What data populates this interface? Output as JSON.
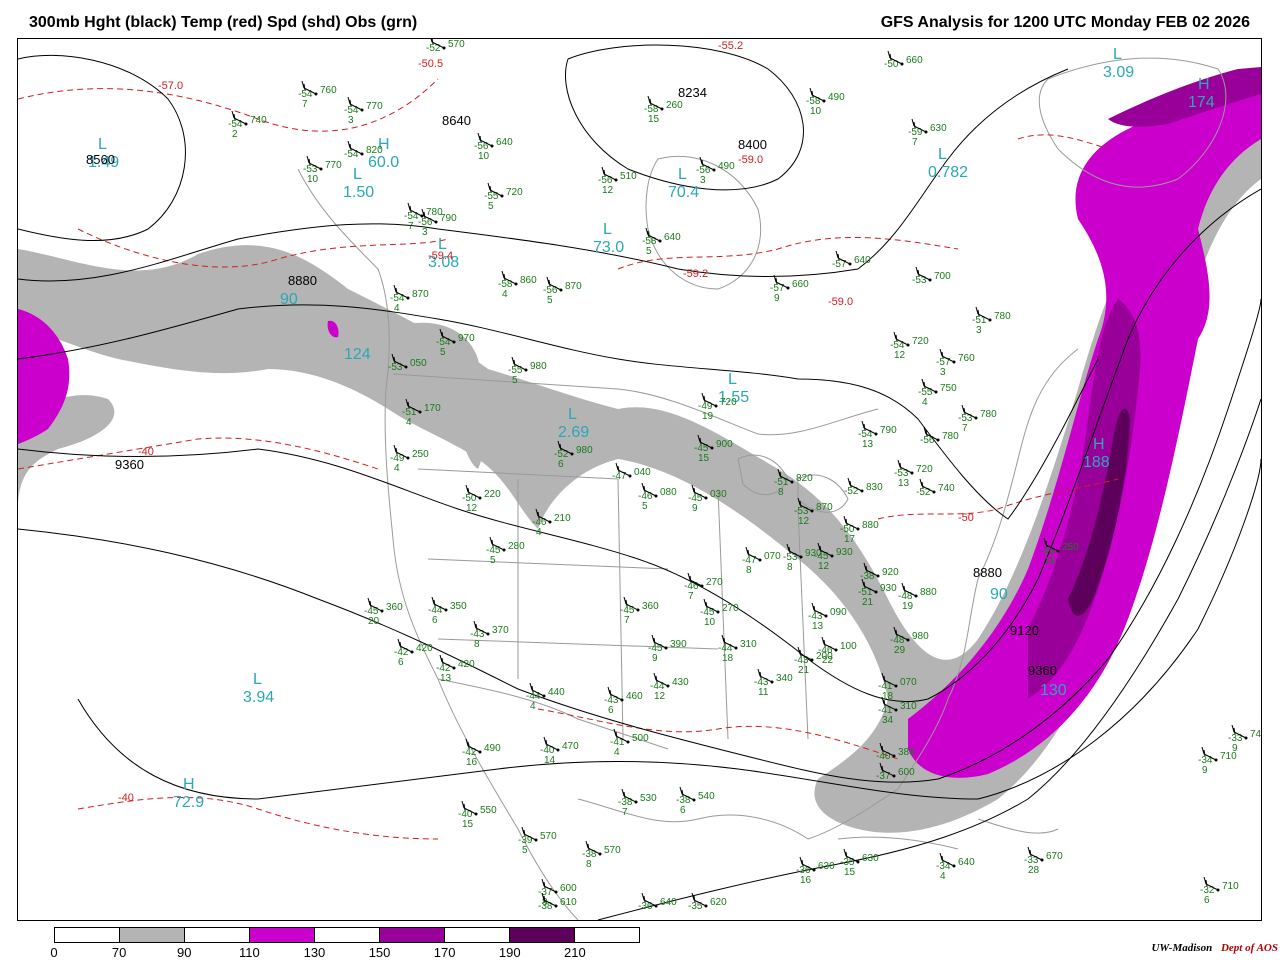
{
  "header": {
    "title_left": "300mb Hght (black) Temp (red) Spd (shd) Obs (grn)",
    "title_right": "GFS Analysis for 1200 UTC Monday  FEB 02 2026"
  },
  "colors": {
    "height_contour": "#000000",
    "temperature_contour": "#cc2020",
    "observation_text": "#1a7a1a",
    "speed_label": "#2aa8b8",
    "speed_70_90": "#b4b4b4",
    "speed_110_130": "#cc00cc",
    "speed_150_170": "#990099",
    "speed_190_210": "#5c005c",
    "geography": "#9a9a9a"
  },
  "colorbar": {
    "segments": [
      "#ffffff",
      "#b4b4b4",
      "#ffffff",
      "#cc00cc",
      "#ffffff",
      "#990099",
      "#ffffff",
      "#5c005c",
      "#ffffff"
    ],
    "ticks": [
      "0",
      "70",
      "90",
      "110",
      "130",
      "150",
      "170",
      "190",
      "210"
    ]
  },
  "credit": {
    "university": "UW-Madison",
    "department": "Dept of AOS"
  },
  "height_labels": [
    "8560",
    "8640",
    "8234",
    "8400",
    "8880",
    "9360",
    "8880",
    "9120",
    "9360"
  ],
  "temperature_labels": [
    "-57.0",
    "-50.5",
    "-55.2",
    "-59.0",
    "-59.4",
    "-59.2",
    "-59.0",
    "-40",
    "-40",
    "-50"
  ],
  "speed_centers": [
    {
      "letter": "L",
      "value": "1.49"
    },
    {
      "letter": "H",
      "value": "60.0"
    },
    {
      "letter": "L",
      "value": "1.50"
    },
    {
      "letter": "L",
      "value": "3.08"
    },
    {
      "letter": "L",
      "value": "70.4"
    },
    {
      "letter": "L",
      "value": "73.0"
    },
    {
      "letter": "L",
      "value": "0.782"
    },
    {
      "letter": "L",
      "value": "3.09"
    },
    {
      "letter": "H",
      "value": "174"
    },
    {
      "letter": "L",
      "value": "1.55"
    },
    {
      "letter": "L",
      "value": "2.69"
    },
    {
      "letter": "H",
      "value": "188"
    },
    {
      "letter": "L",
      "value": "3.94"
    },
    {
      "letter": "H",
      "value": "72.9"
    }
  ],
  "speed_values": [
    "90",
    "124",
    "90",
    "130"
  ],
  "observations": [
    {
      "temp": "-54",
      "height": "760",
      "wind": "7"
    },
    {
      "temp": "-54",
      "height": "770",
      "wind": "3"
    },
    {
      "temp": "-54",
      "height": "740",
      "wind": "2"
    },
    {
      "temp": "-54",
      "height": "820",
      "wind": ""
    },
    {
      "temp": "-53",
      "height": "770",
      "wind": "10"
    },
    {
      "temp": "-52",
      "height": "570",
      "wind": ""
    },
    {
      "temp": "-56",
      "height": "640",
      "wind": "10"
    },
    {
      "temp": "-55",
      "height": "720",
      "wind": "5"
    },
    {
      "temp": "-54",
      "height": "780",
      "wind": "7"
    },
    {
      "temp": "-56",
      "height": "790",
      "wind": "3"
    },
    {
      "temp": "-58",
      "height": "860",
      "wind": "4"
    },
    {
      "temp": "-56",
      "height": "870",
      "wind": "5"
    },
    {
      "temp": "-54",
      "height": "870",
      "wind": "4"
    },
    {
      "temp": "-56",
      "height": "510",
      "wind": "12"
    },
    {
      "temp": "-56",
      "height": "490",
      "wind": "3"
    },
    {
      "temp": "-58",
      "height": "640",
      "wind": "5"
    },
    {
      "temp": "-58",
      "height": "260",
      "wind": "15"
    },
    {
      "temp": "-58",
      "height": "490",
      "wind": "10"
    },
    {
      "temp": "-59",
      "height": "630",
      "wind": "7"
    },
    {
      "temp": "-50",
      "height": "660",
      "wind": ""
    },
    {
      "temp": "-57",
      "height": "640",
      "wind": ""
    },
    {
      "temp": "-57",
      "height": "660",
      "wind": "9"
    },
    {
      "temp": "-53",
      "height": "700",
      "wind": ""
    },
    {
      "temp": "-51",
      "height": "780",
      "wind": "3"
    },
    {
      "temp": "-54",
      "height": "720",
      "wind": "12"
    },
    {
      "temp": "-57",
      "height": "760",
      "wind": "3"
    },
    {
      "temp": "-55",
      "height": "750",
      "wind": "4"
    },
    {
      "temp": "-53",
      "height": "780",
      "wind": "7"
    },
    {
      "temp": "-56",
      "height": "780",
      "wind": ""
    },
    {
      "temp": "-54",
      "height": "790",
      "wind": "13"
    },
    {
      "temp": "-53",
      "height": "720",
      "wind": "13"
    },
    {
      "temp": "-52",
      "height": "740",
      "wind": ""
    },
    {
      "temp": "-52",
      "height": "830",
      "wind": ""
    },
    {
      "temp": "-53",
      "height": "870",
      "wind": "12"
    },
    {
      "temp": "-50",
      "height": "880",
      "wind": "17"
    },
    {
      "temp": "-53",
      "height": "930",
      "wind": "8"
    },
    {
      "temp": "-49",
      "height": "720",
      "wind": "19"
    },
    {
      "temp": "-45",
      "height": "900",
      "wind": "15"
    },
    {
      "temp": "-54",
      "height": "970",
      "wind": "5"
    },
    {
      "temp": "-55",
      "height": "980",
      "wind": "5"
    },
    {
      "temp": "-53",
      "height": "050",
      "wind": ""
    },
    {
      "temp": "-51",
      "height": "170",
      "wind": "4"
    },
    {
      "temp": "-49",
      "height": "250",
      "wind": "4"
    },
    {
      "temp": "-52",
      "height": "980",
      "wind": "6"
    },
    {
      "temp": "-47",
      "height": "040",
      "wind": ""
    },
    {
      "temp": "-46",
      "height": "080",
      "wind": "5"
    },
    {
      "temp": "-45",
      "height": "030",
      "wind": "9"
    },
    {
      "temp": "-51",
      "height": "820",
      "wind": "8"
    },
    {
      "temp": "-50",
      "height": "220",
      "wind": "12"
    },
    {
      "temp": "-46",
      "height": "210",
      "wind": "4"
    },
    {
      "temp": "-45",
      "height": "280",
      "wind": "5"
    },
    {
      "temp": "-47",
      "height": "070",
      "wind": "8"
    },
    {
      "temp": "-45",
      "height": "930",
      "wind": "12"
    },
    {
      "temp": "-46",
      "height": "270",
      "wind": "7"
    },
    {
      "temp": "-45",
      "height": "270",
      "wind": "10"
    },
    {
      "temp": "-43",
      "height": "090",
      "wind": "13"
    },
    {
      "temp": "-45",
      "height": "360",
      "wind": "20"
    },
    {
      "temp": "-44",
      "height": "350",
      "wind": "6"
    },
    {
      "temp": "-45",
      "height": "360",
      "wind": "7"
    },
    {
      "temp": "-43",
      "height": "370",
      "wind": "8"
    },
    {
      "temp": "-42",
      "height": "420",
      "wind": "6"
    },
    {
      "temp": "-42",
      "height": "420",
      "wind": "13"
    },
    {
      "temp": "-45",
      "height": "390",
      "wind": "9"
    },
    {
      "temp": "-44",
      "height": "310",
      "wind": "18"
    },
    {
      "temp": "-43",
      "height": "200",
      "wind": "21"
    },
    {
      "temp": "-46",
      "height": "100",
      "wind": "22"
    },
    {
      "temp": "-44",
      "height": "430",
      "wind": "12"
    },
    {
      "temp": "-44",
      "height": "440",
      "wind": "4"
    },
    {
      "temp": "-43",
      "height": "460",
      "wind": "6"
    },
    {
      "temp": "-43",
      "height": "340",
      "wind": "11"
    },
    {
      "temp": "-38",
      "height": "920",
      "wind": ""
    },
    {
      "temp": "-51",
      "height": "930",
      "wind": "21"
    },
    {
      "temp": "-48",
      "height": "880",
      "wind": "19"
    },
    {
      "temp": "-48",
      "height": "980",
      "wind": "29"
    },
    {
      "temp": "-41",
      "height": "070",
      "wind": "18"
    },
    {
      "temp": "-41",
      "height": "310",
      "wind": "34"
    },
    {
      "temp": "-36",
      "height": "250",
      "wind": "18"
    },
    {
      "temp": "-42",
      "height": "490",
      "wind": "16"
    },
    {
      "temp": "-40",
      "height": "470",
      "wind": "14"
    },
    {
      "temp": "-41",
      "height": "500",
      "wind": "4"
    },
    {
      "temp": "-40",
      "height": "550",
      "wind": "15"
    },
    {
      "temp": "-38",
      "height": "530",
      "wind": "7"
    },
    {
      "temp": "-38",
      "height": "540",
      "wind": "6"
    },
    {
      "temp": "-39",
      "height": "570",
      "wind": "5"
    },
    {
      "temp": "-38",
      "height": "570",
      "wind": "8"
    },
    {
      "temp": "-37",
      "height": "600",
      "wind": "8"
    },
    {
      "temp": "-38",
      "height": "610",
      "wind": ""
    },
    {
      "temp": "-36",
      "height": "640",
      "wind": ""
    },
    {
      "temp": "-35",
      "height": "620",
      "wind": ""
    },
    {
      "temp": "-36",
      "height": "630",
      "wind": "16"
    },
    {
      "temp": "-35",
      "height": "630",
      "wind": "15"
    },
    {
      "temp": "-34",
      "height": "640",
      "wind": "4"
    },
    {
      "temp": "-33",
      "height": "670",
      "wind": "28"
    },
    {
      "temp": "-34",
      "height": "710",
      "wind": "9"
    },
    {
      "temp": "-33",
      "height": "740",
      "wind": "9"
    },
    {
      "temp": "-32",
      "height": "710",
      "wind": "6"
    },
    {
      "temp": "-37",
      "height": "600",
      "wind": ""
    },
    {
      "temp": "-40",
      "height": "380",
      "wind": ""
    }
  ]
}
